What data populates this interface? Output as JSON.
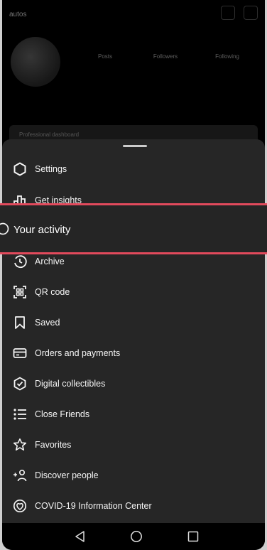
{
  "profile": {
    "username": "autos",
    "posts_label": "Posts",
    "followers_label": "Followers",
    "following_label": "Following",
    "edit_profile_label": "Professional dashboard"
  },
  "menu": {
    "items": [
      {
        "label": "Settings",
        "icon": "settings-icon"
      },
      {
        "label": "Get insights",
        "icon": "insights-icon"
      },
      {
        "label": "Archive",
        "icon": "archive-icon"
      },
      {
        "label": "QR code",
        "icon": "qr-code-icon"
      },
      {
        "label": "Saved",
        "icon": "bookmark-icon"
      },
      {
        "label": "Orders and payments",
        "icon": "card-icon"
      },
      {
        "label": "Digital collectibles",
        "icon": "collectibles-icon"
      },
      {
        "label": "Close Friends",
        "icon": "close-friends-icon"
      },
      {
        "label": "Favorites",
        "icon": "star-icon"
      },
      {
        "label": "Discover people",
        "icon": "add-person-icon"
      },
      {
        "label": "COVID-19 Information Center",
        "icon": "covid-icon"
      }
    ],
    "highlighted": {
      "label": "Your activity",
      "icon": "activity-icon"
    }
  },
  "colors": {
    "highlight": "#e24a5c",
    "sheet": "#262626"
  }
}
